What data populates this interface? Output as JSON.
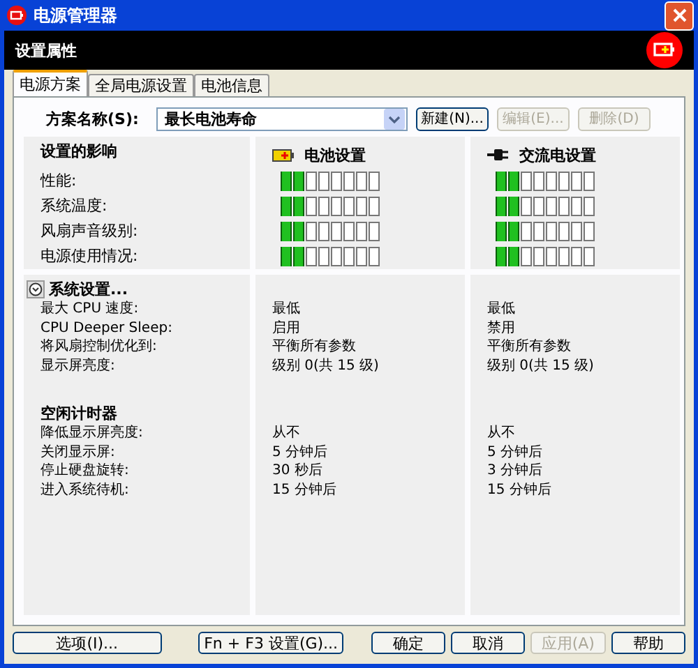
{
  "window": {
    "title": "电源管理器"
  },
  "header": {
    "title": "设置属性"
  },
  "tabs": [
    {
      "label": "电源方案",
      "selected": true
    },
    {
      "label": "全局电源设置",
      "selected": false
    },
    {
      "label": "电池信息",
      "selected": false
    }
  ],
  "scheme": {
    "label": "方案名称(S):",
    "value": "最长电池寿命",
    "buttons": [
      {
        "label": "新建(N)...",
        "disabled": false
      },
      {
        "label": "编辑(E)...",
        "disabled": true
      },
      {
        "label": "删除(D)",
        "disabled": true
      }
    ]
  },
  "impact": {
    "title": "设置的影响",
    "rows": [
      "性能:",
      "系统温度:",
      "风扇声音级别:",
      "电源使用情况:"
    ],
    "columns": [
      {
        "kind": "battery",
        "title": "电池设置",
        "meters": [
          {
            "level": 0.25
          },
          {
            "level": 0.25
          },
          {
            "level": 0.25
          },
          {
            "level": 0.25
          }
        ]
      },
      {
        "kind": "ac",
        "title": "交流电设置",
        "meters": [
          {
            "level": 0.25
          },
          {
            "level": 0.25
          },
          {
            "level": 0.25
          },
          {
            "level": 0.25
          }
        ]
      }
    ]
  },
  "system": {
    "title": "系统设置...",
    "expanded": true,
    "rows": [
      {
        "label": "最大 CPU 速度:",
        "values": [
          "最低",
          "最低"
        ]
      },
      {
        "label": "CPU Deeper Sleep:",
        "values": [
          "启用",
          "禁用"
        ]
      },
      {
        "label": "将风扇控制优化到:",
        "values": [
          "平衡所有参数",
          "平衡所有参数"
        ]
      },
      {
        "label": "显示屏亮度:",
        "values": [
          "级别 0(共 15 级)",
          "级别 0(共 15 级)"
        ]
      }
    ]
  },
  "idle": {
    "title": "空闲计时器",
    "rows": [
      {
        "label": "降低显示屏亮度:",
        "values": [
          "从不",
          "从不"
        ]
      },
      {
        "label": "关闭显示屏:",
        "values": [
          "5 分钟后",
          "5 分钟后"
        ]
      },
      {
        "label": "停止硬盘旋转:",
        "values": [
          "30 秒后",
          "3 分钟后"
        ]
      },
      {
        "label": "进入系统待机:",
        "values": [
          "15 分钟后",
          "15 分钟后"
        ]
      }
    ]
  },
  "buttons": [
    {
      "label": "选项(I)...",
      "disabled": false
    },
    {
      "label": "Fn + F3 设置(G)...",
      "disabled": false
    },
    {
      "label": "确定",
      "disabled": false
    },
    {
      "label": "取消",
      "disabled": false
    },
    {
      "label": "应用(A)",
      "disabled": true
    },
    {
      "label": "帮助",
      "disabled": false
    }
  ]
}
